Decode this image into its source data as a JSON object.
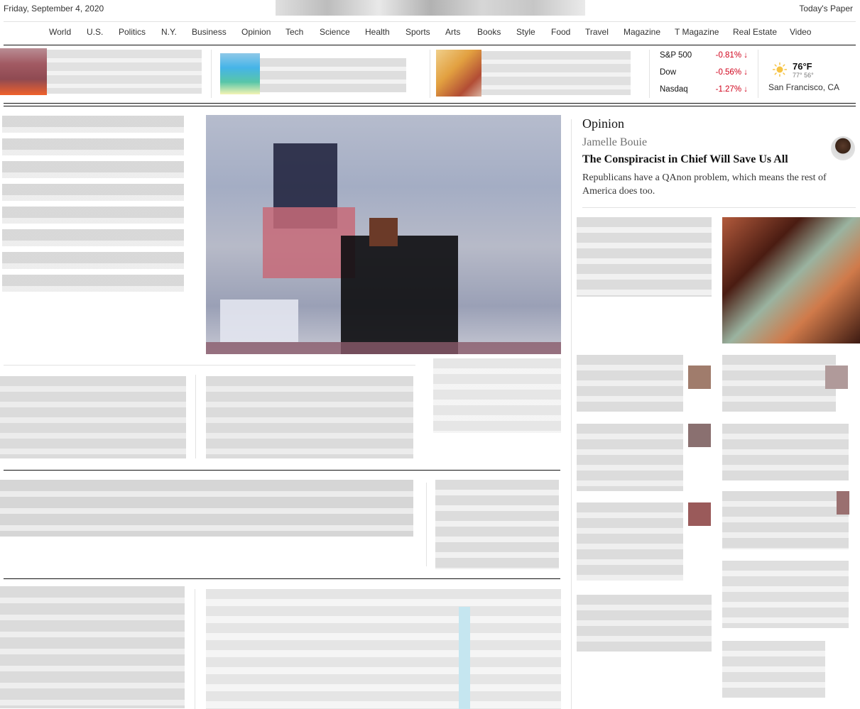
{
  "header": {
    "date": "Friday, September 4, 2020",
    "todays_paper": "Today's Paper"
  },
  "nav": {
    "items": [
      "World",
      "U.S.",
      "Politics",
      "N.Y.",
      "Business",
      "Opinion",
      "Tech",
      "Science",
      "Health",
      "Sports",
      "Arts",
      "Books",
      "Style",
      "Food",
      "Travel",
      "Magazine",
      "T Magazine",
      "Real Estate",
      "Video"
    ]
  },
  "markets": [
    {
      "name": "S&P 500",
      "change": "-0.81%"
    },
    {
      "name": "Dow",
      "change": "-0.56%"
    },
    {
      "name": "Nasdaq",
      "change": "-1.27%"
    }
  ],
  "weather": {
    "temp": "76°F",
    "high": "77°",
    "low": "56°",
    "city": "San Francisco, CA",
    "icon": "sun-icon"
  },
  "opinion": {
    "label": "Opinion",
    "author": "Jamelle Bouie",
    "headline": "The Conspiracist in Chief Will Save Us All",
    "summary": "Republicans have a QAnon problem, which means the rest of America does too."
  },
  "colors": {
    "negative": "#d0021b",
    "rule_dark": "#121212",
    "rule_light": "#e2e2e2"
  }
}
